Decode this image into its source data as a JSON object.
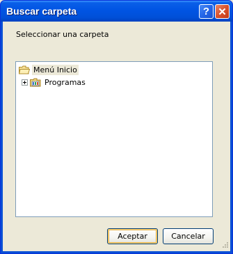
{
  "window": {
    "title": "Buscar carpeta",
    "help_icon": "help-icon",
    "close_icon": "close-icon"
  },
  "dialog": {
    "prompt": "Seleccionar una carpeta"
  },
  "tree": {
    "root": {
      "label": "Menú Inicio",
      "icon": "open-folder-icon",
      "selected": true
    },
    "children": [
      {
        "label": "Programas",
        "icon": "programs-folder-icon",
        "expandable": true
      }
    ]
  },
  "buttons": {
    "ok_label": "Aceptar",
    "cancel_label": "Cancelar"
  },
  "colors": {
    "title_bar": "#0054e3",
    "close_button": "#d9512c",
    "dialog_background": "#ece9d8",
    "tree_border": "#7f9db9"
  }
}
